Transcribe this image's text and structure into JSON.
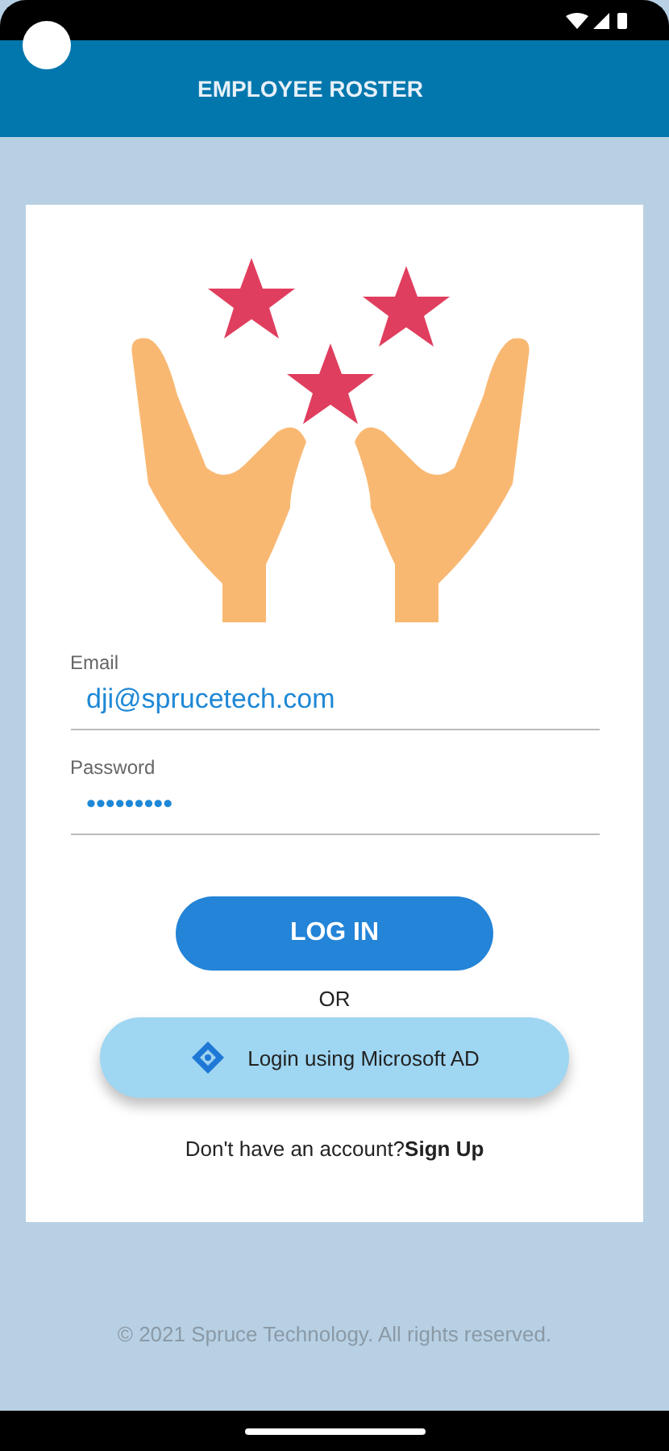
{
  "app_bar": {
    "title": "EMPLOYEE ROSTER"
  },
  "form": {
    "fields": [
      {
        "label": "Email",
        "value": "dji@sprucetech.com"
      },
      {
        "label": "Password",
        "value": "•••••••••"
      }
    ],
    "login_button": "LOG IN",
    "separator": "OR",
    "ad_button": "Login using Microsoft AD",
    "signup": {
      "prompt": "Don't have an account?",
      "link": "Sign Up"
    }
  },
  "footer": "© 2021 Spruce Technology. All rights reserved."
}
